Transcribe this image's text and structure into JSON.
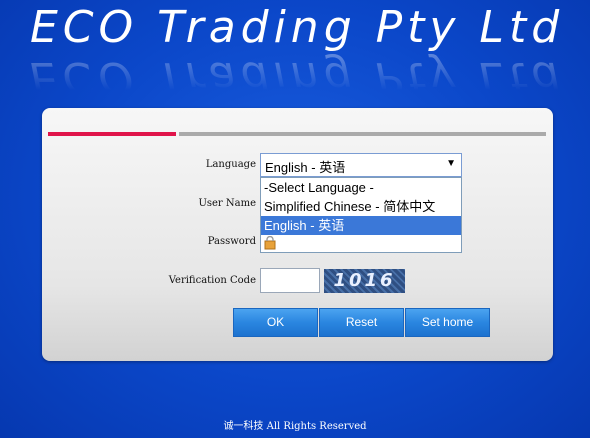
{
  "header": {
    "title": "ECO Trading Pty Ltd"
  },
  "form": {
    "language_label": "Language",
    "language_selected": "English - 英语",
    "language_options": [
      "-Select Language -",
      "Simplified Chinese - 简体中文",
      "English - 英语"
    ],
    "username_label": "User Name",
    "password_label": "Password",
    "verification_label": "Verification Code",
    "captcha_text": "1016"
  },
  "buttons": {
    "ok": "OK",
    "reset": "Reset",
    "set_home": "Set home"
  },
  "footer": {
    "copyright": "诚一科技  All Rights Reserved"
  },
  "colors": {
    "background": "#0b47c9",
    "accent_bar": "#e0144a",
    "button": "#2a86e0",
    "selected_option": "#3b78d8"
  }
}
